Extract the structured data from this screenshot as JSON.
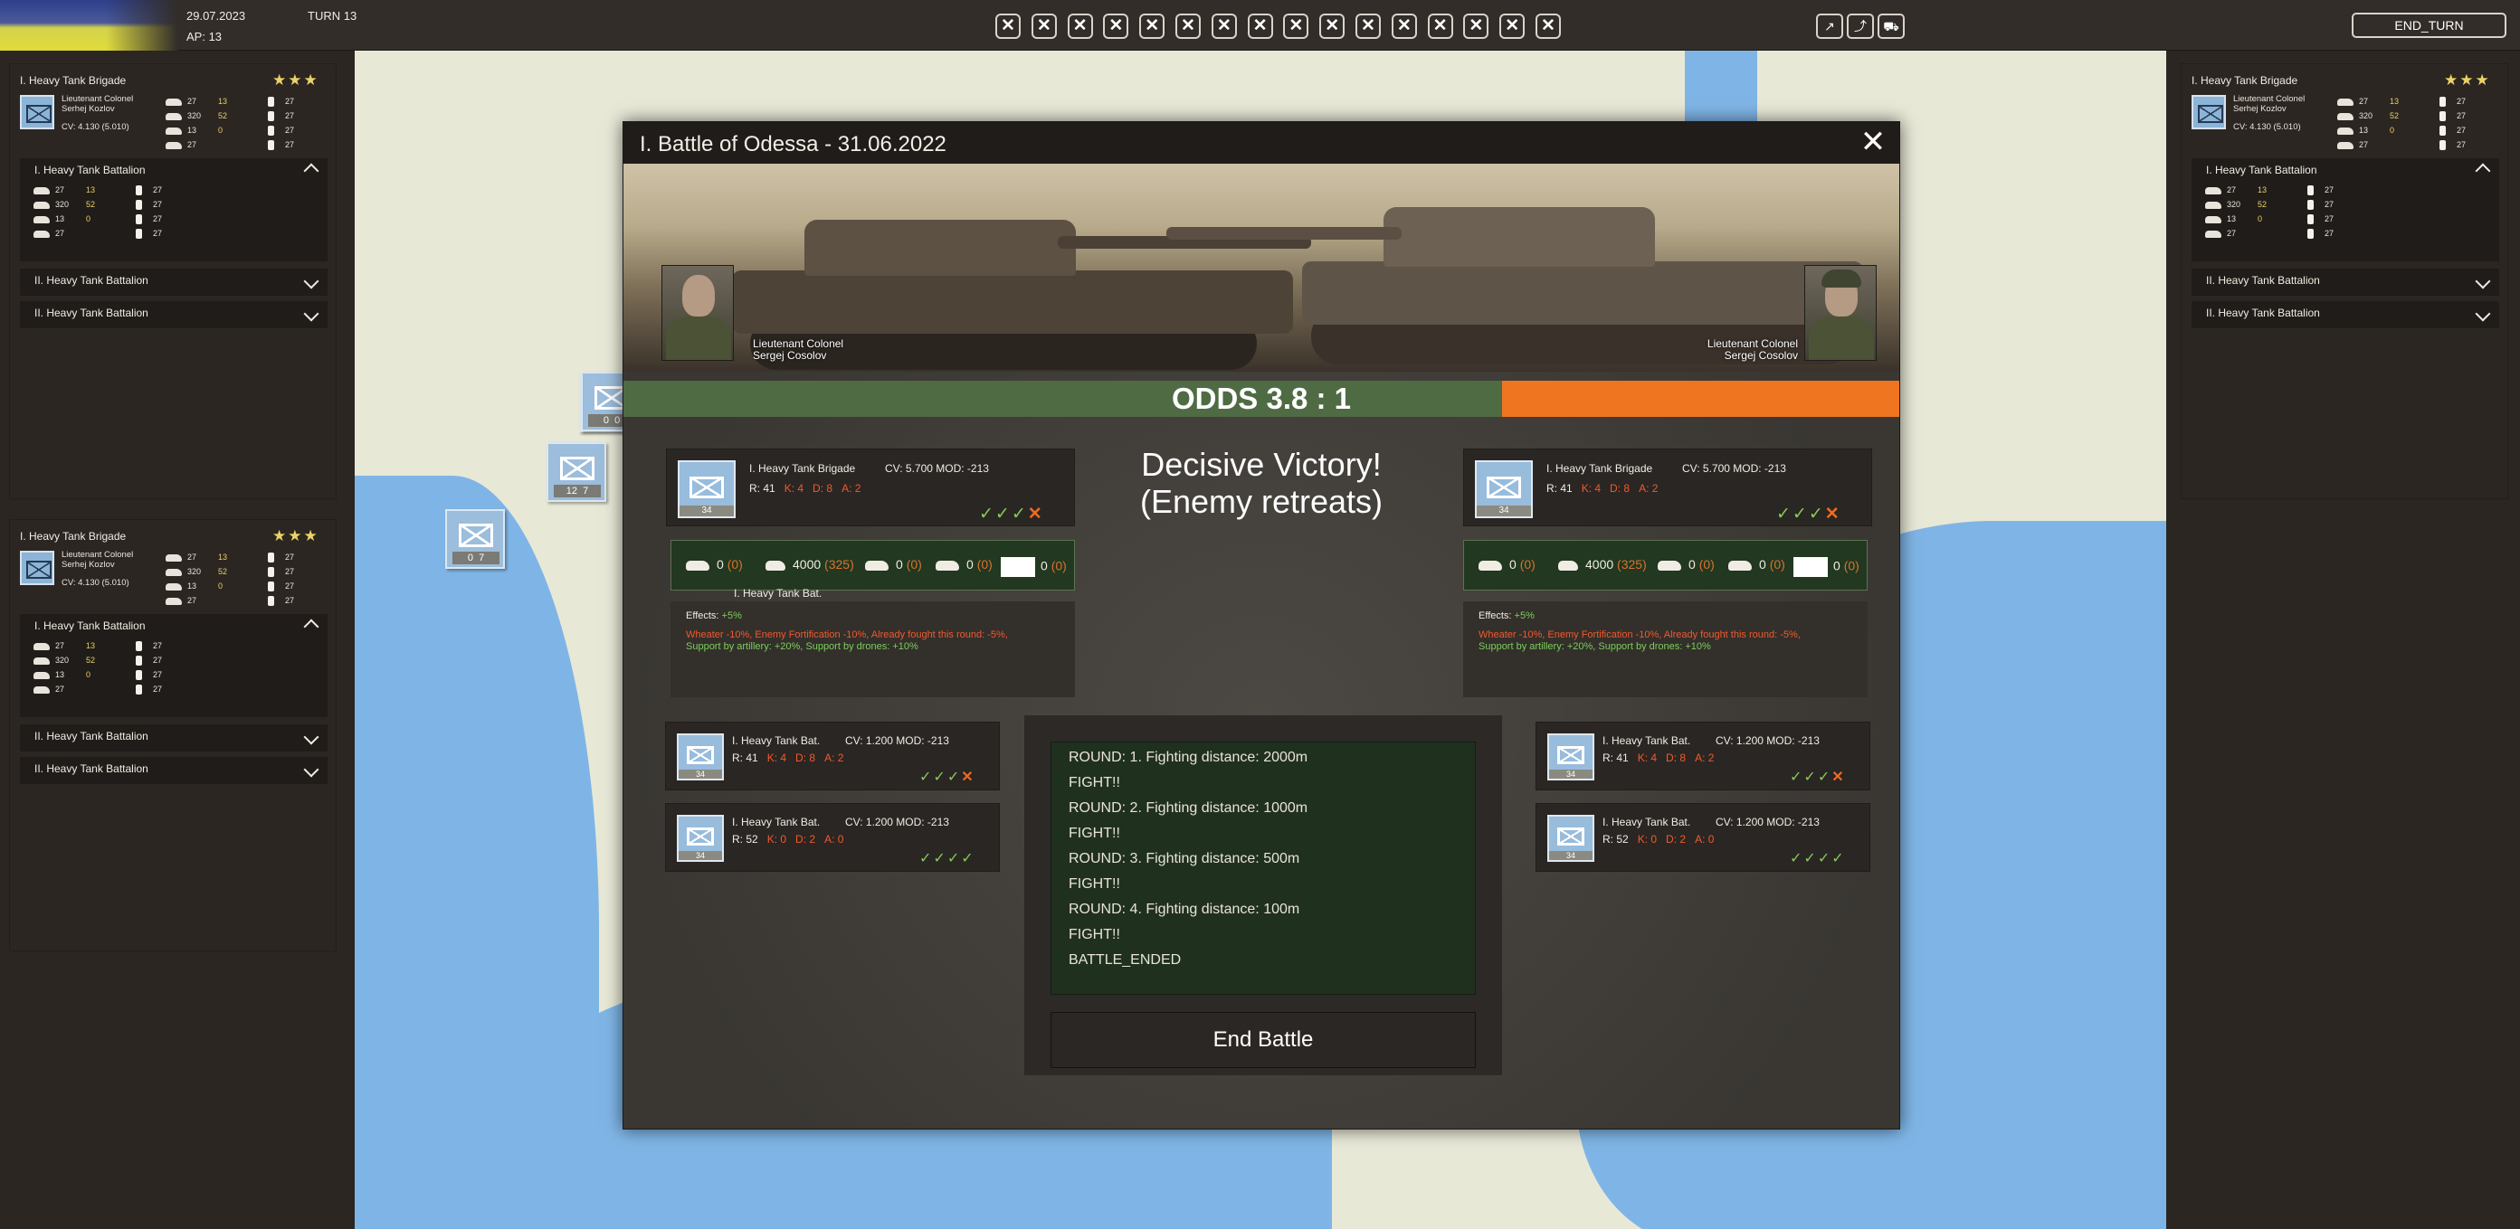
{
  "topbar": {
    "date": "29.07.2023",
    "turn": "TURN 13",
    "ap": "AP: 13",
    "end_turn": "END_TURN",
    "filter_buttons": [
      "✕",
      "✕",
      "✕",
      "✕",
      "✕",
      "✕",
      "✕",
      "✕",
      "✕",
      "✕",
      "✕",
      "✕",
      "✕",
      "✕",
      "✕",
      "✕"
    ],
    "mode_buttons": [
      "↗",
      "⤴",
      "⛟"
    ]
  },
  "left_panel_1": {
    "brigade": "I. Heavy Tank Brigade",
    "stars": "★★★",
    "commander_rank": "Lieutenant Colonel",
    "commander_name": "Serhej Kozlov",
    "cv": "CV: 4.130 (5.010)",
    "stats": [
      {
        "a": "27",
        "b": "13",
        "c": "27"
      },
      {
        "a": "320",
        "b": "52",
        "c": "27"
      },
      {
        "a": "13",
        "b": "0",
        "c": "27"
      },
      {
        "a": "27",
        "b": "",
        "c": "27"
      }
    ],
    "open_battalion": "I. Heavy Tank Battalion",
    "battalion_stats": [
      {
        "a": "27",
        "b": "13",
        "c": "27"
      },
      {
        "a": "320",
        "b": "52",
        "c": "27"
      },
      {
        "a": "13",
        "b": "0",
        "c": "27"
      },
      {
        "a": "27",
        "b": "",
        "c": "27"
      }
    ],
    "collapsed": [
      "II. Heavy Tank Battalion",
      "II. Heavy Tank Battalion"
    ]
  },
  "left_panel_2": {
    "brigade": "I. Heavy Tank Brigade",
    "stars": "★★★",
    "commander_rank": "Lieutenant Colonel",
    "commander_name": "Serhej Kozlov",
    "cv": "CV: 4.130 (5.010)",
    "stats": [
      {
        "a": "27",
        "b": "13",
        "c": "27"
      },
      {
        "a": "320",
        "b": "52",
        "c": "27"
      },
      {
        "a": "13",
        "b": "0",
        "c": "27"
      },
      {
        "a": "27",
        "b": "",
        "c": "27"
      }
    ],
    "open_battalion": "I. Heavy Tank Battalion",
    "battalion_stats": [
      {
        "a": "27",
        "b": "13",
        "c": "27"
      },
      {
        "a": "320",
        "b": "52",
        "c": "27"
      },
      {
        "a": "13",
        "b": "0",
        "c": "27"
      },
      {
        "a": "27",
        "b": "",
        "c": "27"
      }
    ],
    "collapsed": [
      "II. Heavy Tank Battalion",
      "II. Heavy Tank Battalion"
    ]
  },
  "right_panel": {
    "brigade": "I. Heavy Tank Brigade",
    "stars": "★★★",
    "commander_rank": "Lieutenant Colonel",
    "commander_name": "Serhej Kozlov",
    "cv": "CV: 4.130 (5.010)",
    "stats": [
      {
        "a": "27",
        "b": "13",
        "c": "27"
      },
      {
        "a": "320",
        "b": "52",
        "c": "27"
      },
      {
        "a": "13",
        "b": "0",
        "c": "27"
      },
      {
        "a": "27",
        "b": "",
        "c": "27"
      }
    ],
    "open_battalion": "I. Heavy Tank Battalion",
    "battalion_stats": [
      {
        "a": "27",
        "b": "13",
        "c": "27"
      },
      {
        "a": "320",
        "b": "52",
        "c": "27"
      },
      {
        "a": "13",
        "b": "0",
        "c": "27"
      },
      {
        "a": "27",
        "b": "",
        "c": "27"
      }
    ],
    "collapsed": [
      "II. Heavy Tank Battalion",
      "II. Heavy Tank Battalion"
    ]
  },
  "map_counters": [
    {
      "l": "0",
      "r": "0"
    },
    {
      "l": "12",
      "r": "7"
    },
    {
      "l": "0",
      "r": "7"
    }
  ],
  "battle": {
    "title": "I. Battle of Odessa - 31.06.2022",
    "close": "✕",
    "left_commander": {
      "rank": "Lieutenant Colonel",
      "name": "Sergej Cosolov"
    },
    "right_commander": {
      "rank": "Lieutenant Colonel",
      "name": "Sergej Cosolov"
    },
    "odds": "ODDS 3.8 : 1",
    "odds_attacker_share": 0.689,
    "verdict_1": "Decisive Victory!",
    "verdict_2": "(Enemy retreats)",
    "left_brigade": {
      "name": "I. Heavy Tank Brigade",
      "cv": "CV: 5.700 MOD: -213",
      "r": "R: 41",
      "k": "K: 4",
      "d": "D: 8",
      "a": "A: 2",
      "count": "34",
      "checks": "✓✓✓",
      "x": "✕"
    },
    "right_brigade": {
      "name": "I. Heavy Tank Brigade",
      "cv": "CV: 5.700 MOD: -213",
      "r": "R: 41",
      "k": "K: 4",
      "d": "D: 8",
      "a": "A: 2",
      "count": "34",
      "checks": "✓✓✓",
      "x": "✕"
    },
    "strip_left": {
      "tanks": "0",
      "tanks_loss": "(0)",
      "infantry": "4000",
      "infantry_loss": "(325)",
      "apc": "0",
      "apc_loss": "(0)",
      "arty": "0",
      "arty_loss": "(0)",
      "other": "0",
      "other_loss": "(0)",
      "sub": "I. Heavy Tank Bat."
    },
    "strip_right": {
      "tanks": "0",
      "tanks_loss": "(0)",
      "infantry": "4000",
      "infantry_loss": "(325)",
      "apc": "0",
      "apc_loss": "(0)",
      "arty": "0",
      "arty_loss": "(0)",
      "other": "0",
      "other_loss": "(0)"
    },
    "effects_label": "Effects:",
    "effects_value": "+5%",
    "effects_red": "Wheater -10%, Enemy Fortification -10%, Already fought this round: -5%,",
    "effects_green": "Support by artillery: +20%, Support by drones: +10%",
    "left_batts": [
      {
        "name": "I. Heavy Tank Bat.",
        "cv": "CV: 1.200 MOD: -213",
        "r": "R: 41",
        "k": "K: 4",
        "d": "D: 8",
        "a": "A: 2",
        "count": "34",
        "checks": "✓✓✓",
        "x": "✕"
      },
      {
        "name": "I. Heavy Tank Bat.",
        "cv": "CV: 1.200 MOD: -213",
        "r": "R: 52",
        "k": "K: 0",
        "d": "D: 2",
        "a": "A: 0",
        "count": "34",
        "checks": "✓✓✓✓",
        "x": ""
      }
    ],
    "right_batts": [
      {
        "name": "I. Heavy Tank Bat.",
        "cv": "CV: 1.200 MOD: -213",
        "r": "R: 41",
        "k": "K: 4",
        "d": "D: 8",
        "a": "A: 2",
        "count": "34",
        "checks": "✓✓✓",
        "x": "✕"
      },
      {
        "name": "I. Heavy Tank Bat.",
        "cv": "CV: 1.200 MOD: -213",
        "r": "R: 52",
        "k": "K: 0",
        "d": "D: 2",
        "a": "A: 0",
        "count": "34",
        "checks": "✓✓✓✓",
        "x": ""
      }
    ],
    "log": [
      "ROUND: 1. Fighting distance: 2000m",
      "FIGHT!!",
      "ROUND: 2. Fighting distance: 1000m",
      "FIGHT!!",
      "ROUND: 3. Fighting distance: 500m",
      "FIGHT!!",
      "ROUND: 4. Fighting distance: 100m",
      "FIGHT!!",
      "BATTLE_ENDED"
    ],
    "end_battle": "End Battle"
  },
  "colors": {
    "odds_attacker": "#4f6b44",
    "odds_defender": "#ef7521",
    "loss_red": "#ef5a2e",
    "bonus_green": "#7bcf5a",
    "star_gold": "#ecd267"
  }
}
